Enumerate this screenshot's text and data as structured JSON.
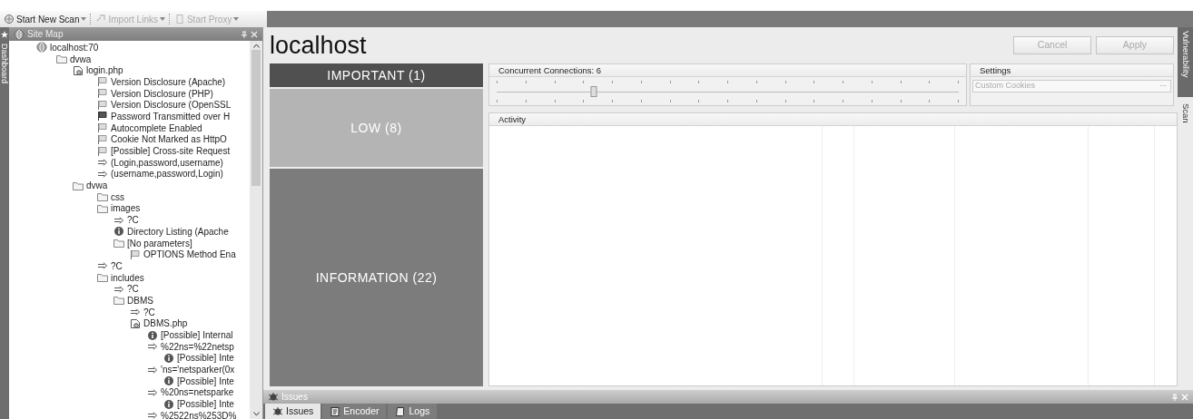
{
  "toolbar": {
    "items": [
      {
        "label": "Start New Scan",
        "kind": "scan",
        "disabled": false
      },
      {
        "label": "Import Links",
        "kind": "import",
        "disabled": true
      },
      {
        "label": "Start Proxy",
        "kind": "proxy",
        "disabled": true
      }
    ]
  },
  "side_tab": {
    "label": "Dashboard"
  },
  "site_map": {
    "title": "Site Map",
    "tree": [
      {
        "label": "localhost:70",
        "kind": "host",
        "children": [
          {
            "label": "dvwa",
            "kind": "folder",
            "children": [
              {
                "label": "login.php",
                "kind": "page",
                "children": [
                  {
                    "label": "Version Disclosure (Apache)",
                    "kind": "flag"
                  },
                  {
                    "label": "Version Disclosure (PHP)",
                    "kind": "flag"
                  },
                  {
                    "label": "Version Disclosure (OpenSSL",
                    "kind": "flag"
                  },
                  {
                    "label": "Password Transmitted over H",
                    "kind": "flag-high"
                  },
                  {
                    "label": "Autocomplete Enabled",
                    "kind": "flag"
                  },
                  {
                    "label": "Cookie Not Marked as HttpO",
                    "kind": "flag"
                  },
                  {
                    "label": "[Possible] Cross-site Request",
                    "kind": "flag"
                  },
                  {
                    "label": "(Login,password,username)",
                    "kind": "parameter"
                  },
                  {
                    "label": "(username,password,Login)",
                    "kind": "parameter"
                  }
                ]
              },
              {
                "label": "dvwa",
                "kind": "folder",
                "children": [
                  {
                    "label": "css",
                    "kind": "folder"
                  },
                  {
                    "label": "images",
                    "kind": "folder",
                    "children": [
                      {
                        "label": "?C",
                        "kind": "parameter"
                      },
                      {
                        "label": "Directory Listing (Apache",
                        "kind": "info"
                      },
                      {
                        "label": "[No parameters]",
                        "kind": "folder",
                        "children": [
                          {
                            "label": "OPTIONS Method Ena",
                            "kind": "flag"
                          }
                        ]
                      }
                    ]
                  },
                  {
                    "label": "?C",
                    "kind": "parameter"
                  },
                  {
                    "label": "includes",
                    "kind": "folder",
                    "children": [
                      {
                        "label": "?C",
                        "kind": "parameter"
                      },
                      {
                        "label": "DBMS",
                        "kind": "folder",
                        "children": [
                          {
                            "label": "?C",
                            "kind": "parameter"
                          },
                          {
                            "label": "DBMS.php",
                            "kind": "page",
                            "children": [
                              {
                                "label": "[Possible] Internal",
                                "kind": "info"
                              },
                              {
                                "label": "%22ns=%22netsp",
                                "kind": "parameter",
                                "children": [
                                  {
                                    "label": "[Possible] Inte",
                                    "kind": "info"
                                  }
                                ]
                              },
                              {
                                "label": "'ns='netsparker(0x",
                                "kind": "parameter",
                                "children": [
                                  {
                                    "label": "[Possible] Inte",
                                    "kind": "info"
                                  }
                                ]
                              },
                              {
                                "label": "%20ns=netsparke",
                                "kind": "parameter",
                                "children": [
                                  {
                                    "label": "[Possible] Inte",
                                    "kind": "info"
                                  }
                                ]
                              },
                              {
                                "label": "%2522ns%253D%",
                                "kind": "parameter"
                              }
                            ]
                          }
                        ]
                      }
                    ]
                  }
                ]
              }
            ]
          }
        ]
      }
    ]
  },
  "page_title": "localhost",
  "buttons": [
    {
      "label": "Cancel",
      "disabled": true
    },
    {
      "label": "Apply",
      "disabled": true
    }
  ],
  "severity": [
    {
      "label": "IMPORTANT (1)",
      "color": "#505050"
    },
    {
      "label": "LOW (8)",
      "color": "#b4b4b4"
    },
    {
      "label": "INFORMATION (22)",
      "color": "#7c7c7c"
    }
  ],
  "connections": {
    "label": "Concurrent Connections: 6",
    "level": 0.21
  },
  "settings": {
    "title": "Settings",
    "field": {
      "placeholder": "Custom Cookies"
    },
    "button": "···"
  },
  "activity": {
    "title": "Activity"
  },
  "right_tabs": [
    {
      "label": "Vulnerability",
      "selected": true
    },
    {
      "label": "Scan",
      "selected": false
    }
  ],
  "bottom_panel": {
    "title": "Issues",
    "tabs": [
      {
        "label": "Issues",
        "selected": true
      },
      {
        "label": "Encoder",
        "selected": false
      },
      {
        "label": "Logs",
        "selected": false
      }
    ]
  }
}
